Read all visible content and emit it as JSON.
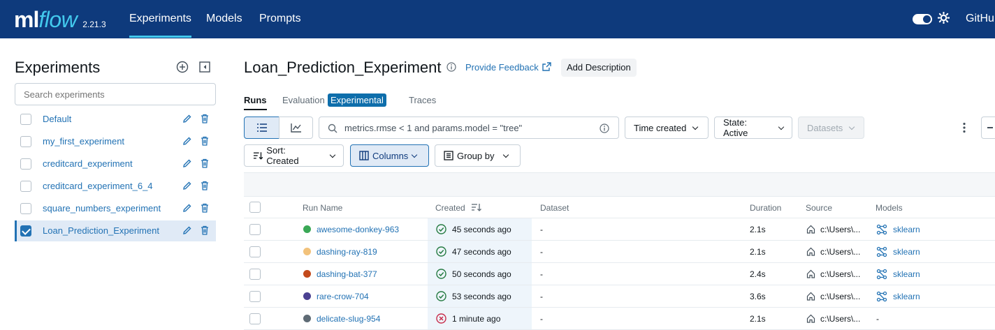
{
  "nav": {
    "logo_ml": "ml",
    "logo_flow": "flow",
    "version": "2.21.3",
    "links": [
      "Experiments",
      "Models",
      "Prompts"
    ],
    "github": "GitHu"
  },
  "sidebar": {
    "title": "Experiments",
    "search_placeholder": "Search experiments",
    "experiments": [
      {
        "name": "Default",
        "checked": false
      },
      {
        "name": "my_first_experiment",
        "checked": false
      },
      {
        "name": "creditcard_experiment",
        "checked": false
      },
      {
        "name": "creditcard_experiment_6_4",
        "checked": false
      },
      {
        "name": "square_numbers_experiment",
        "checked": false
      },
      {
        "name": "Loan_Prediction_Experiment",
        "checked": true
      }
    ]
  },
  "main": {
    "title": "Loan_Prediction_Experiment",
    "feedback": "Provide Feedback",
    "add_description": "Add Description",
    "tabs": {
      "runs": "Runs",
      "evaluation": "Evaluation",
      "experimental_badge": "Experimental",
      "traces": "Traces"
    },
    "search_query": "metrics.rmse < 1 and params.model = \"tree\"",
    "time_created": "Time created",
    "state": "State: Active",
    "datasets": "Datasets",
    "sort": "Sort: Created",
    "columns": "Columns",
    "group_by": "Group by"
  },
  "table": {
    "headers": {
      "run_name": "Run Name",
      "created": "Created",
      "dataset": "Dataset",
      "duration": "Duration",
      "source": "Source",
      "models": "Models"
    },
    "rows": [
      {
        "run_name": "awesome-donkey-963",
        "color": "#3aa856",
        "status": "success",
        "created": "45 seconds ago",
        "dataset": "-",
        "duration": "2.1s",
        "source": "c:\\Users\\...",
        "model": "sklearn"
      },
      {
        "run_name": "dashing-ray-819",
        "color": "#f2c27b",
        "status": "success",
        "created": "47 seconds ago",
        "dataset": "-",
        "duration": "2.1s",
        "source": "c:\\Users\\...",
        "model": "sklearn"
      },
      {
        "run_name": "dashing-bat-377",
        "color": "#c34a1b",
        "status": "success",
        "created": "50 seconds ago",
        "dataset": "-",
        "duration": "2.4s",
        "source": "c:\\Users\\...",
        "model": "sklearn"
      },
      {
        "run_name": "rare-crow-704",
        "color": "#4b4192",
        "status": "success",
        "created": "53 seconds ago",
        "dataset": "-",
        "duration": "3.6s",
        "source": "c:\\Users\\...",
        "model": "sklearn"
      },
      {
        "run_name": "delicate-slug-954",
        "color": "#5f6b75",
        "status": "failed",
        "created": "1 minute ago",
        "dataset": "-",
        "duration": "2.1s",
        "source": "c:\\Users\\...",
        "model": "-"
      }
    ]
  },
  "colors": {
    "nav_bg": "#0e3a7c",
    "accent": "#43c9ed",
    "link": "#2272b4",
    "success": "#277c43",
    "failed": "#c82d4c"
  }
}
